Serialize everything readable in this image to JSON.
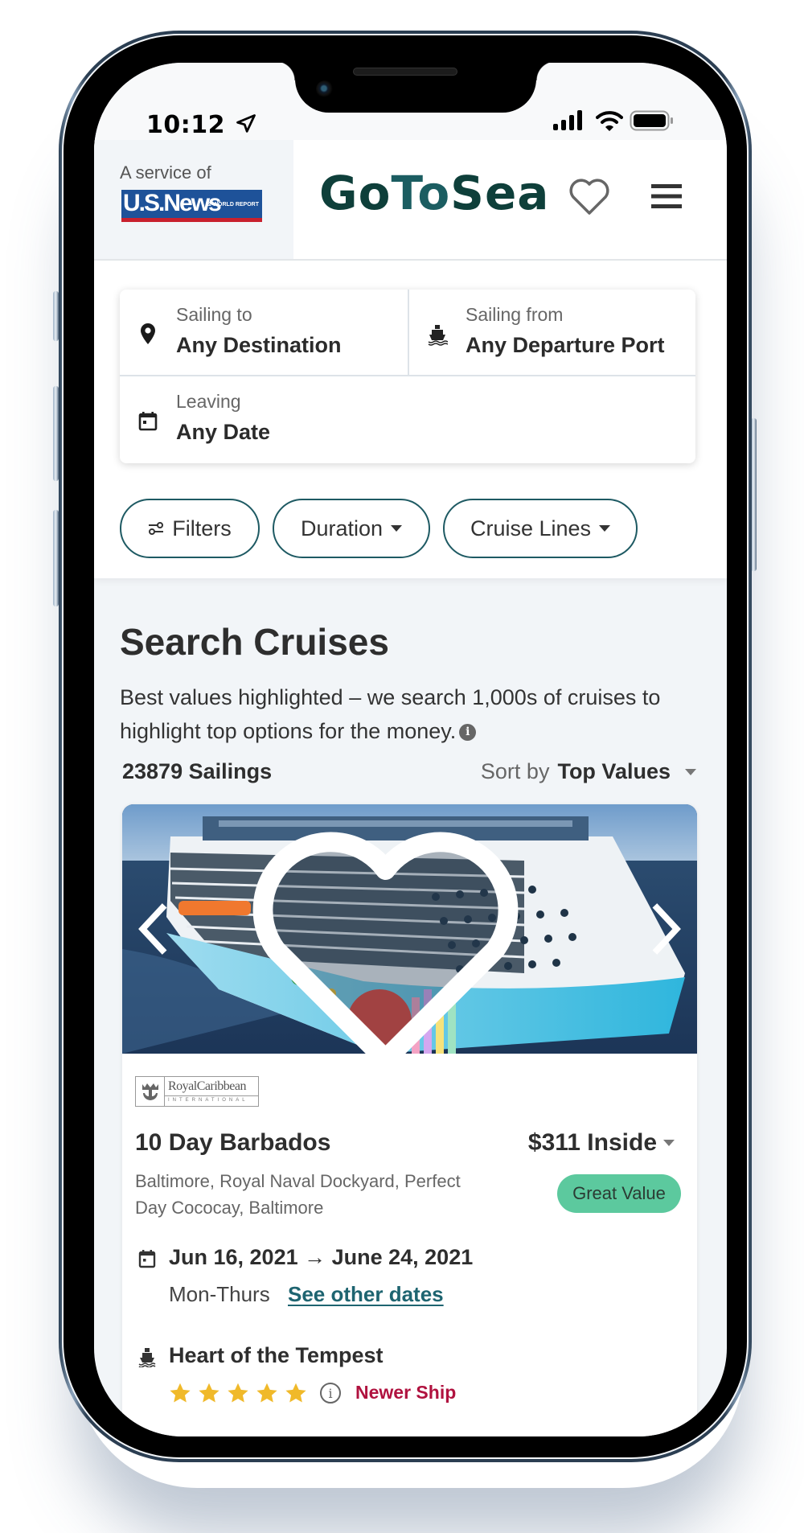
{
  "status_bar": {
    "time": "10:12",
    "icons": [
      "location-arrow-icon",
      "cellular-signal-icon",
      "wifi-icon",
      "battery-icon"
    ]
  },
  "header": {
    "service_label": "A service of",
    "partner_logo": "U.S.News",
    "partner_logo_sub": "& WORLD REPORT",
    "brand_parts": [
      "Go",
      "To",
      "Sea"
    ],
    "favorites_icon": "heart-outline-icon",
    "menu_icon": "hamburger-menu-icon",
    "brand_colors": {
      "dark": "#0e3f3a",
      "teal": "#1b5d61"
    }
  },
  "search": {
    "destination": {
      "label": "Sailing to",
      "value": "Any Destination",
      "icon": "map-pin-icon"
    },
    "port": {
      "label": "Sailing from",
      "value": "Any Departure Port",
      "icon": "ship-icon"
    },
    "date": {
      "label": "Leaving",
      "value": "Any Date",
      "icon": "calendar-icon"
    },
    "filters": [
      {
        "label": "Filters",
        "icon": "sliders-icon"
      },
      {
        "label": "Duration",
        "icon": "caret-down-icon"
      },
      {
        "label": "Cruise Lines",
        "icon": "caret-down-icon"
      }
    ],
    "accent_color": "#1e5a63"
  },
  "results": {
    "title": "Search Cruises",
    "description": "Best values highlighted – we search 1,000s of cruises to highlight top options for the money.",
    "info_icon": "i",
    "count_label": "23879 Sailings",
    "sort_label": "Sort by",
    "sort_value": "Top Values"
  },
  "card": {
    "cruise_line_top": "RoyalCaribbean",
    "cruise_line_bottom": "INTERNATIONAL",
    "name": "10 Day Barbados",
    "ports": "Baltimore, Royal Naval Dockyard, Perfect Day Cococay, Baltimore",
    "price": "$311 Inside",
    "badge": "Great Value",
    "badge_color": "#5cc99e",
    "date_range": "Jun 16, 2021 → June 24, 2021",
    "day_pattern": "Mon-Thurs",
    "other_dates_link": "See other dates",
    "ship_name": "Heart of the Tempest",
    "rating_stars": 5,
    "rating_max": 5,
    "ship_tag": "Newer Ship",
    "ship_tag_color": "#b0123f",
    "star_color": "#f0b92a"
  }
}
